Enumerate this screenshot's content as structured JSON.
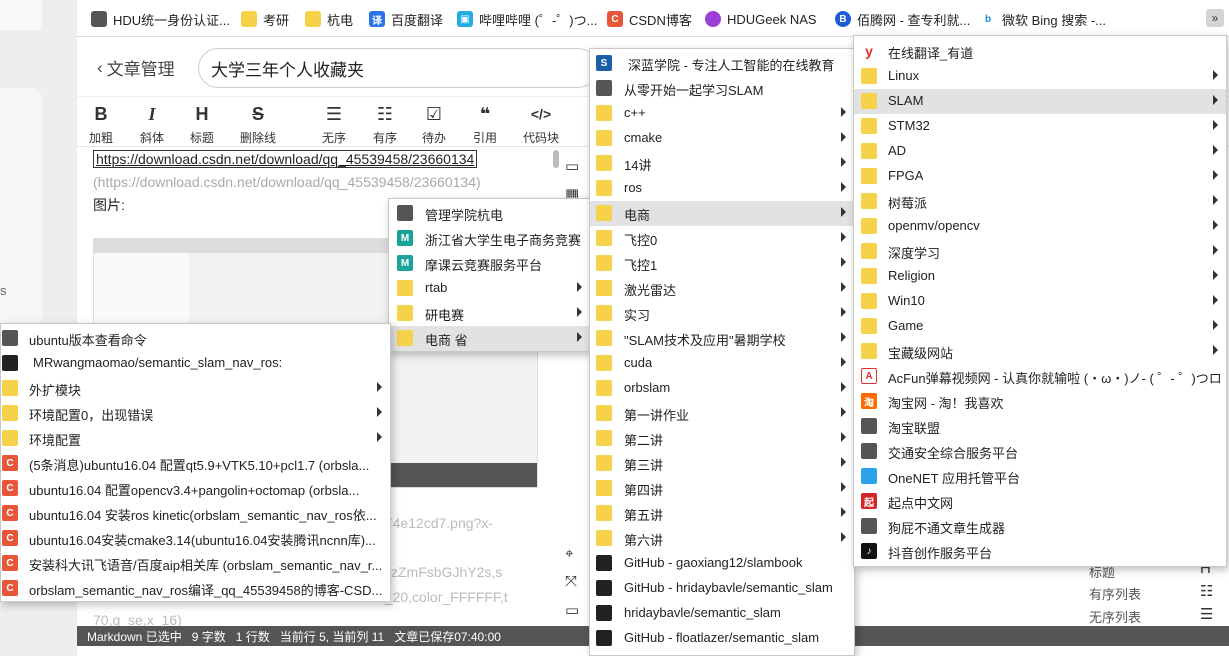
{
  "bookmarks_bar": {
    "items": [
      {
        "label": "HDU统一身份认证...",
        "icon": "globe-icon"
      },
      {
        "label": "考研",
        "icon": "folder-icon"
      },
      {
        "label": "杭电",
        "icon": "folder-icon"
      },
      {
        "label": "百度翻译",
        "icon": "baidu-translate-icon"
      },
      {
        "label": "哔哩哔哩 (゜-゜)つ...",
        "icon": "bilibili-icon"
      },
      {
        "label": "CSDN博客",
        "icon": "csdn-icon"
      },
      {
        "label": "HDUGeek NAS",
        "icon": "cloud-icon"
      },
      {
        "label": "佰腾网 - 查专利就...",
        "icon": "baiteng-icon"
      },
      {
        "label": "微软 Bing 搜索 -...",
        "icon": "bing-icon"
      }
    ],
    "overflow_label": "»"
  },
  "editor": {
    "back_label": "文章管理",
    "title_value": "大学三年个人收藏夹",
    "toolbar": [
      {
        "icon": "B",
        "label": "加粗"
      },
      {
        "icon": "I",
        "label": "斜体"
      },
      {
        "icon": "H",
        "label": "标题"
      },
      {
        "icon": "S",
        "label": "删除线"
      },
      {
        "icon": "☰",
        "label": "无序"
      },
      {
        "icon": "☷",
        "label": "有序"
      },
      {
        "icon": "☑",
        "label": "待办"
      },
      {
        "icon": "❝",
        "label": "引用"
      },
      {
        "icon": "</>",
        "label": "代码块"
      }
    ],
    "lines": {
      "link": "https://download.csdn.net/download/qq_45539458/23660134",
      "link_paren": "(https://download.csdn.net/download/qq_45539458/23660134)",
      "image_label": "图片:",
      "frag1": "b74e12cd7.png?x-",
      "frag2": "W5zZmFsbGJhY2s,s",
      "frag3": "ze_20,color_FFFFFF,t",
      "frag4": "70,g_se,x_16)"
    },
    "status": {
      "mode": "Markdown 已选中",
      "chars": "9 字数",
      "lines": "1 行数",
      "pos": "当前行 5, 当前列 11",
      "saved": "文章已保存07:40:00"
    },
    "right_panel": {
      "r1": "标题",
      "r2": "有序列表",
      "r3": "无序列表"
    },
    "left_char": "s"
  },
  "menu_left": [
    {
      "label": "ubuntu版本查看命令",
      "icon": "globe-icon",
      "sub": false
    },
    {
      "label": "MRwangmaomao/semantic_slam_nav_ros:",
      "icon": "github-icon",
      "sub": false
    },
    {
      "label": "外扩模块",
      "icon": "folder-icon",
      "sub": true
    },
    {
      "label": "环境配置0，出现错误",
      "icon": "folder-icon",
      "sub": true
    },
    {
      "label": "环境配置",
      "icon": "folder-icon",
      "sub": true
    },
    {
      "label": "(5条消息)ubuntu16.04 配置qt5.9+VTK5.10+pcl1.7 (orbsla...",
      "icon": "csdn-icon",
      "sub": false
    },
    {
      "label": "ubuntu16.04 配置opencv3.4+pangolin+octomap (orbsla...",
      "icon": "csdn-icon",
      "sub": false
    },
    {
      "label": "ubuntu16.04 安装ros kinetic(orbslam_semantic_nav_ros依...",
      "icon": "csdn-icon",
      "sub": false
    },
    {
      "label": "ubuntu16.04安装cmake3.14(ubuntu16.04安装腾讯ncnn库)...",
      "icon": "csdn-icon",
      "sub": false
    },
    {
      "label": "安装科大讯飞语音/百度aip相关库 (orbslam_semantic_nav_r...",
      "icon": "csdn-icon",
      "sub": false
    },
    {
      "label": "orbslam_semantic_nav_ros编译_qq_45539458的博客-CSD...",
      "icon": "csdn-icon",
      "sub": false
    }
  ],
  "menu_mid_small": [
    {
      "label": "管理学院杭电",
      "icon": "globe-icon",
      "sub": false
    },
    {
      "label": "浙江省大学生电子商务竞赛",
      "icon": "mk-icon",
      "sub": false
    },
    {
      "label": "摩课云竞赛服务平台",
      "icon": "mk-icon",
      "sub": false
    },
    {
      "label": "rtab",
      "icon": "folder-icon",
      "sub": true
    },
    {
      "label": "研电赛",
      "icon": "folder-icon",
      "sub": true
    },
    {
      "label": "电商 省",
      "icon": "folder-icon",
      "sub": true
    }
  ],
  "menu_mid": [
    {
      "label": "深蓝学院 - 专注人工智能的在线教育",
      "icon": "shenlan-icon",
      "sub": false
    },
    {
      "label": "从零开始一起学习SLAM",
      "icon": "globe-icon",
      "sub": false
    },
    {
      "label": "c++",
      "icon": "folder-icon",
      "sub": true
    },
    {
      "label": "cmake",
      "icon": "folder-icon",
      "sub": true
    },
    {
      "label": "14讲",
      "icon": "folder-icon",
      "sub": true
    },
    {
      "label": "ros",
      "icon": "folder-icon",
      "sub": true
    },
    {
      "label": "电商",
      "icon": "folder-icon",
      "sub": true
    },
    {
      "label": "飞控0",
      "icon": "folder-icon",
      "sub": true
    },
    {
      "label": "飞控1",
      "icon": "folder-icon",
      "sub": true
    },
    {
      "label": "激光雷达",
      "icon": "folder-icon",
      "sub": true
    },
    {
      "label": "实习",
      "icon": "folder-icon",
      "sub": true
    },
    {
      "label": "\"SLAM技术及应用\"暑期学校",
      "icon": "folder-icon",
      "sub": true
    },
    {
      "label": "cuda",
      "icon": "folder-icon",
      "sub": true
    },
    {
      "label": "orbslam",
      "icon": "folder-icon",
      "sub": true
    },
    {
      "label": "第一讲作业",
      "icon": "folder-icon",
      "sub": true
    },
    {
      "label": "第二讲",
      "icon": "folder-icon",
      "sub": true
    },
    {
      "label": "第三讲",
      "icon": "folder-icon",
      "sub": true
    },
    {
      "label": "第四讲",
      "icon": "folder-icon",
      "sub": true
    },
    {
      "label": "第五讲",
      "icon": "folder-icon",
      "sub": true
    },
    {
      "label": "第六讲",
      "icon": "folder-icon",
      "sub": true
    },
    {
      "label": "GitHub - gaoxiang12/slambook",
      "icon": "github-icon",
      "sub": false
    },
    {
      "label": "GitHub - hridaybavle/semantic_slam",
      "icon": "github-icon",
      "sub": false
    },
    {
      "label": "hridaybavle/semantic_slam",
      "icon": "github-icon",
      "sub": false
    },
    {
      "label": "GitHub - floatlazer/semantic_slam",
      "icon": "github-icon",
      "sub": false
    }
  ],
  "menu_right": [
    {
      "label": "在线翻译_有道",
      "icon": "youdao-icon",
      "sub": false
    },
    {
      "label": "Linux",
      "icon": "folder-icon",
      "sub": true
    },
    {
      "label": "SLAM",
      "icon": "folder-icon",
      "sub": true
    },
    {
      "label": "STM32",
      "icon": "folder-icon",
      "sub": true
    },
    {
      "label": "AD",
      "icon": "folder-icon",
      "sub": true
    },
    {
      "label": "FPGA",
      "icon": "folder-icon",
      "sub": true
    },
    {
      "label": "树莓派",
      "icon": "folder-icon",
      "sub": true
    },
    {
      "label": "openmv/opencv",
      "icon": "folder-icon",
      "sub": true
    },
    {
      "label": "深度学习",
      "icon": "folder-icon",
      "sub": true
    },
    {
      "label": "Religion",
      "icon": "folder-icon",
      "sub": true
    },
    {
      "label": "Win10",
      "icon": "folder-icon",
      "sub": true
    },
    {
      "label": "Game",
      "icon": "folder-icon",
      "sub": true
    },
    {
      "label": "宝藏级网站",
      "icon": "folder-icon",
      "sub": true
    },
    {
      "label": "AcFun弹幕视频网 - 认真你就输啦 (・ω・)ノ- ( ゜- ゜)つロ",
      "icon": "acfun-icon",
      "sub": false
    },
    {
      "label": "淘宝网 - 淘！我喜欢",
      "icon": "taobao-icon",
      "sub": false
    },
    {
      "label": "淘宝联盟",
      "icon": "globe-icon",
      "sub": false
    },
    {
      "label": "交通安全综合服务平台",
      "icon": "globe-icon",
      "sub": false
    },
    {
      "label": "OneNET 应用托管平台",
      "icon": "onenet-icon",
      "sub": false
    },
    {
      "label": "起点中文网",
      "icon": "qidian-icon",
      "sub": false
    },
    {
      "label": "狗屁不通文章生成器",
      "icon": "globe-icon",
      "sub": false
    },
    {
      "label": "抖音创作服务平台",
      "icon": "douyin-icon",
      "sub": false
    }
  ]
}
